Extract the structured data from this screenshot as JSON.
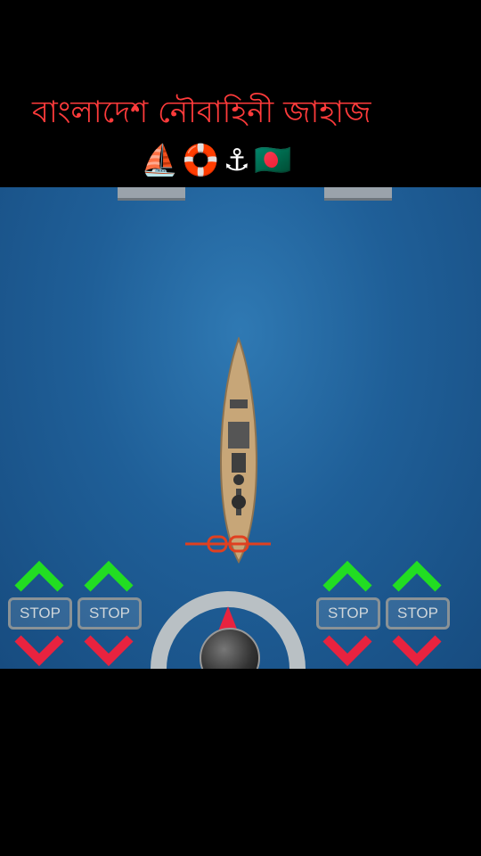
{
  "title": "বাংলাদেশ নৌবাহিনী জাহাজ",
  "emoji_line": "⛵🛟⚓🇧🇩",
  "controls": {
    "stop_label": "STOP",
    "up_color": "#22dd22",
    "down_color": "#e8233f",
    "rudder_indicator_color": "#e8233f"
  },
  "colors": {
    "title": "#ff3b3b",
    "sea": "#1f5f98",
    "background": "#000000"
  }
}
